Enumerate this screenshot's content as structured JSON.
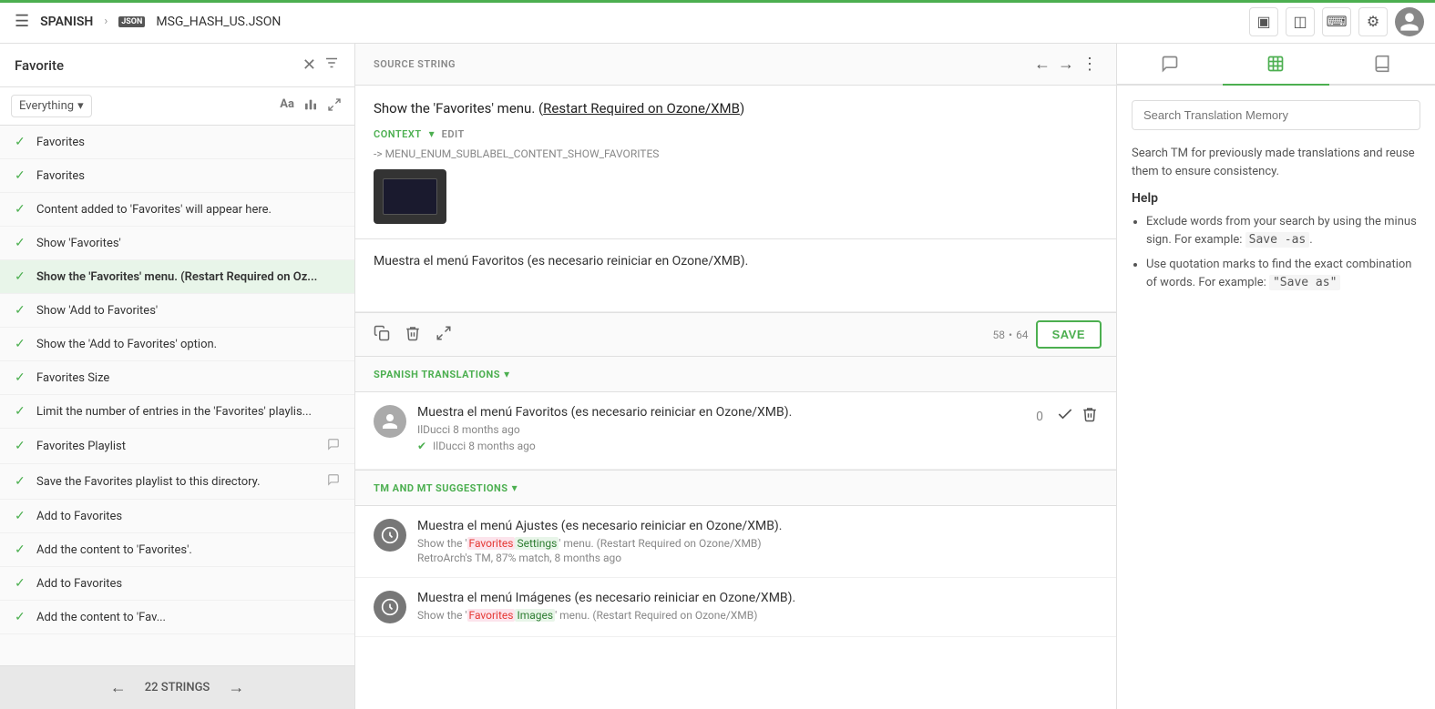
{
  "topbar": {
    "menu_icon": "☰",
    "brand": "SPANISH",
    "chevron": "›",
    "file_icon": "JSON",
    "filename": "MSG_HASH_US.JSON",
    "icons": {
      "layout1": "▣",
      "layout2": "◫",
      "keyboard": "⌨",
      "settings": "⚙",
      "avatar_letter": "👤"
    }
  },
  "sidebar": {
    "title": "Favorite",
    "search_dropdown": "Everything",
    "items": [
      {
        "id": 1,
        "text": "Favorites",
        "bold": false,
        "active": false,
        "has_comment": false
      },
      {
        "id": 2,
        "text": "Favorites",
        "bold": false,
        "active": false,
        "has_comment": false
      },
      {
        "id": 3,
        "text": "Content added to 'Favorites' will appear here.",
        "bold": false,
        "active": false,
        "has_comment": false
      },
      {
        "id": 4,
        "text": "Show 'Favorites'",
        "bold": false,
        "active": false,
        "has_comment": false
      },
      {
        "id": 5,
        "text": "Show the 'Favorites' menu. (Restart Required on Oz...",
        "bold": true,
        "active": true,
        "has_comment": false
      },
      {
        "id": 6,
        "text": "Show 'Add to Favorites'",
        "bold": false,
        "active": false,
        "has_comment": false
      },
      {
        "id": 7,
        "text": "Show the 'Add to Favorites' option.",
        "bold": false,
        "active": false,
        "has_comment": false
      },
      {
        "id": 8,
        "text": "Favorites Size",
        "bold": false,
        "active": false,
        "has_comment": false
      },
      {
        "id": 9,
        "text": "Limit the number of entries in the 'Favorites' playlis...",
        "bold": false,
        "active": false,
        "has_comment": false
      },
      {
        "id": 10,
        "text": "Favorites Playlist",
        "bold": false,
        "active": false,
        "has_comment": true
      },
      {
        "id": 11,
        "text": "Save the Favorites playlist to this directory.",
        "bold": false,
        "active": false,
        "has_comment": true
      },
      {
        "id": 12,
        "text": "Add to Favorites",
        "bold": false,
        "active": false,
        "has_comment": false
      },
      {
        "id": 13,
        "text": "Add the content to 'Favorites'.",
        "bold": false,
        "active": false,
        "has_comment": false
      },
      {
        "id": 14,
        "text": "Add to Favorites",
        "bold": false,
        "active": false,
        "has_comment": false
      },
      {
        "id": 15,
        "text": "Add the content to 'Fav...",
        "bold": false,
        "active": false,
        "has_comment": false
      }
    ],
    "bottom_bar_label": "22 STRINGS",
    "nav_prev": "←",
    "nav_next": "→"
  },
  "source_string": {
    "label": "SOURCE STRING",
    "text": "Show the 'Favorites' menu. (Restart Required on Ozone/XMB)",
    "context_label": "CONTEXT",
    "edit_label": "EDIT",
    "context_path": "-> MENU_ENUM_SUBLABEL_CONTENT_SHOW_FAVORITES"
  },
  "translation_area": {
    "text": "Muestra el menú Favoritos (es necesario reiniciar en Ozone/XMB).",
    "char_count": "58",
    "char_max": "64",
    "save_label": "SAVE",
    "tool_copy": "⧉",
    "tool_delete": "🗑",
    "tool_resize": "⤢"
  },
  "spanish_translations": {
    "label": "SPANISH TRANSLATIONS",
    "items": [
      {
        "id": 1,
        "text": "Muestra el menú Favoritos (es necesario reiniciar en Ozone/XMB).",
        "author": "IlDucci",
        "time": "8 months ago",
        "verified_author": "IlDucci",
        "verified_time": "8 months ago",
        "vote_count": "0"
      }
    ]
  },
  "tm_suggestions": {
    "label": "TM AND MT SUGGESTIONS",
    "items": [
      {
        "id": 1,
        "text": "Muestra el menú Ajustes (es necesario reiniciar en Ozone/XMB).",
        "source_pre": "Show the '",
        "source_highlight_red": "Favorites",
        "source_highlight_green": "Settings",
        "source_post": "' menu. (Restart Required on Ozone/XMB)",
        "match_info": "RetroArch's TM, 87% match, 8 months ago"
      },
      {
        "id": 2,
        "text": "Muestra el menú Imágenes (es necesario reiniciar en Ozone/XMB).",
        "source_pre": "Show the '",
        "source_highlight_red": "Favorites",
        "source_highlight_green": "Images",
        "source_post": "' menu. (Restart Required on Ozone/XMB)",
        "match_info": ""
      }
    ]
  },
  "right_panel": {
    "search_placeholder": "Search Translation Memory",
    "help_intro": "Search TM for previously made translations and reuse them to ensure consistency.",
    "help_title": "Help",
    "help_items": [
      "Exclude words from your search by using the minus sign. For example: Save -as.",
      "Use quotation marks to find the exact combination of words. For example: \"Save as\""
    ]
  }
}
